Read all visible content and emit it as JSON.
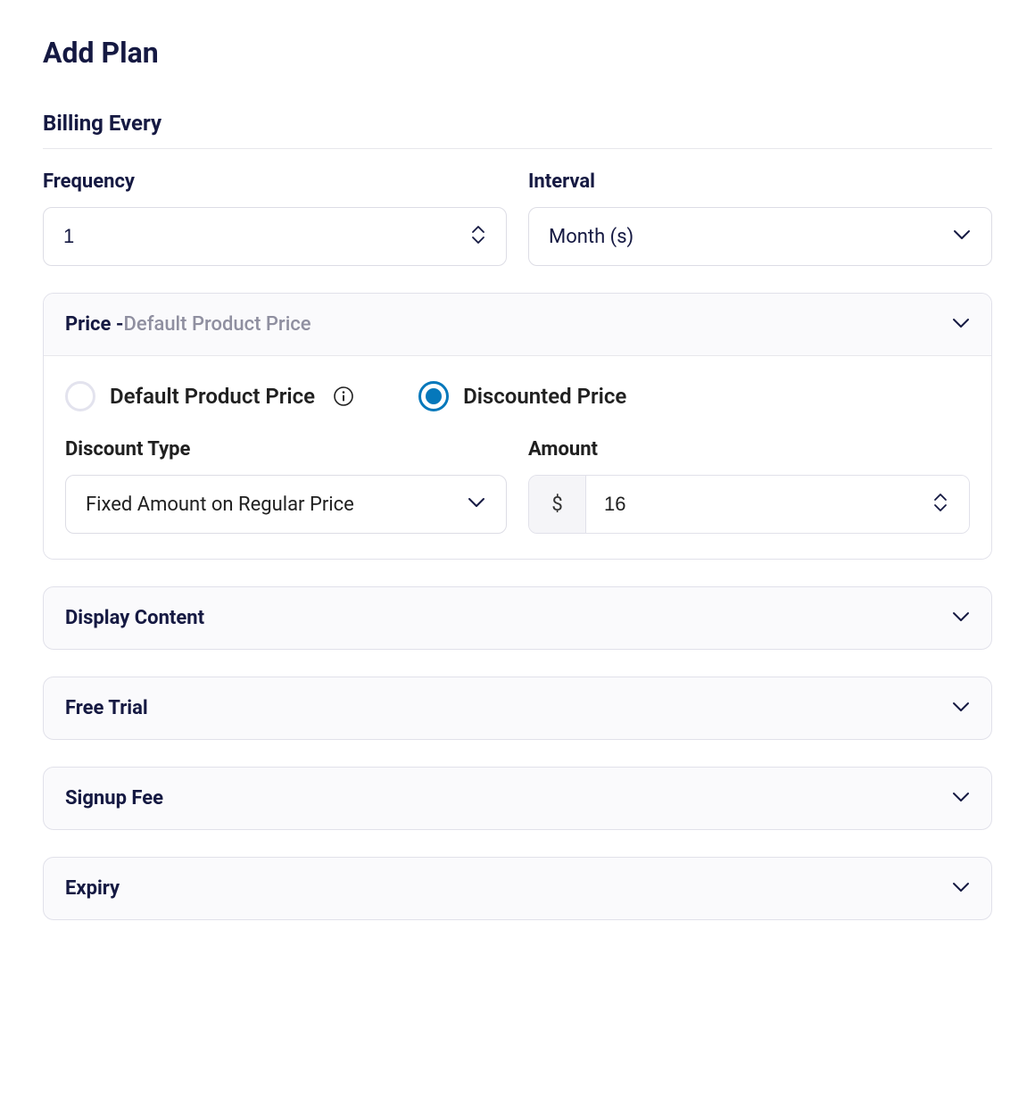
{
  "page_title": "Add Plan",
  "billing_section_title": "Billing Every",
  "frequency": {
    "label": "Frequency",
    "value": "1"
  },
  "interval": {
    "label": "Interval",
    "value": "Month (s)"
  },
  "price_section": {
    "header_label": "Price - ",
    "header_sub": "Default Product Price",
    "radios": {
      "default": "Default Product Price",
      "discounted": "Discounted Price",
      "selected": "discounted"
    },
    "discount_type": {
      "label": "Discount Type",
      "value": "Fixed Amount on Regular Price"
    },
    "amount": {
      "label": "Amount",
      "currency_symbol": "$",
      "value": "16"
    }
  },
  "accordions": {
    "display_content": "Display Content",
    "free_trial": "Free Trial",
    "signup_fee": "Signup Fee",
    "expiry": "Expiry"
  }
}
